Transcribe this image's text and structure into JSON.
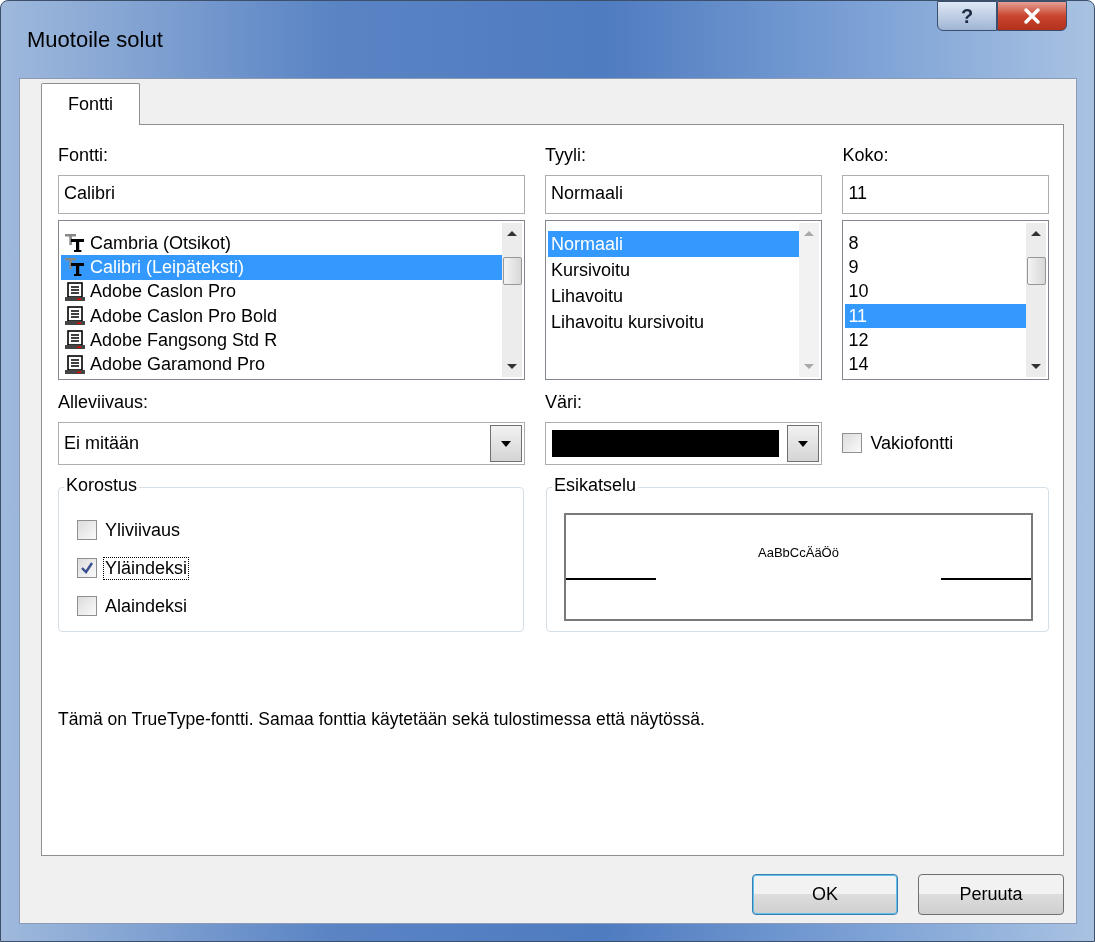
{
  "window": {
    "title": "Muotoile solut",
    "help_button": "?"
  },
  "tabs": [
    {
      "label": "Fontti",
      "selected": true
    }
  ],
  "font": {
    "label": "Fontti:",
    "value": "Calibri",
    "scrollable": true,
    "items": [
      {
        "kind": "truetype",
        "name": "Cambria (Otsikot)",
        "selected": false
      },
      {
        "kind": "truetype",
        "name": "Calibri (Leipäteksti)",
        "selected": true
      },
      {
        "kind": "printer",
        "name": "Adobe Caslon Pro",
        "selected": false
      },
      {
        "kind": "printer",
        "name": "Adobe Caslon Pro Bold",
        "selected": false
      },
      {
        "kind": "printer",
        "name": "Adobe Fangsong Std R",
        "selected": false
      },
      {
        "kind": "printer",
        "name": "Adobe Garamond Pro",
        "selected": false
      }
    ]
  },
  "style": {
    "label": "Tyyli:",
    "value": "Normaali",
    "scrollable": false,
    "items": [
      {
        "name": "Normaali",
        "selected": true
      },
      {
        "name": "Kursivoitu",
        "selected": false
      },
      {
        "name": "Lihavoitu",
        "selected": false
      },
      {
        "name": "Lihavoitu kursivoitu",
        "selected": false
      }
    ]
  },
  "size": {
    "label": "Koko:",
    "value": "11",
    "scrollable": true,
    "items": [
      {
        "name": "8",
        "selected": false
      },
      {
        "name": "9",
        "selected": false
      },
      {
        "name": "10",
        "selected": false
      },
      {
        "name": "11",
        "selected": true
      },
      {
        "name": "12",
        "selected": false
      },
      {
        "name": "14",
        "selected": false
      }
    ]
  },
  "underline": {
    "label": "Alleviivaus:",
    "value": "Ei mitään"
  },
  "color": {
    "label": "Väri:",
    "color": "#000000"
  },
  "normal_font": {
    "label": "Vakiofontti",
    "checked": false
  },
  "effects": {
    "title": "Korostus",
    "items": [
      {
        "label": "Yliviivaus",
        "checked": false,
        "focused": false
      },
      {
        "label": "Yläindeksi",
        "checked": true,
        "focused": true
      },
      {
        "label": "Alaindeksi",
        "checked": false,
        "focused": false
      }
    ]
  },
  "preview": {
    "title": "Esikatselu",
    "sample": "AaBbCcÄäÖö"
  },
  "info": "Tämä on TrueType-fontti. Samaa fonttia käytetään sekä tulostimessa että näytössä.",
  "buttons": [
    {
      "label": "OK",
      "default": true
    },
    {
      "label": "Peruuta",
      "default": false
    }
  ]
}
